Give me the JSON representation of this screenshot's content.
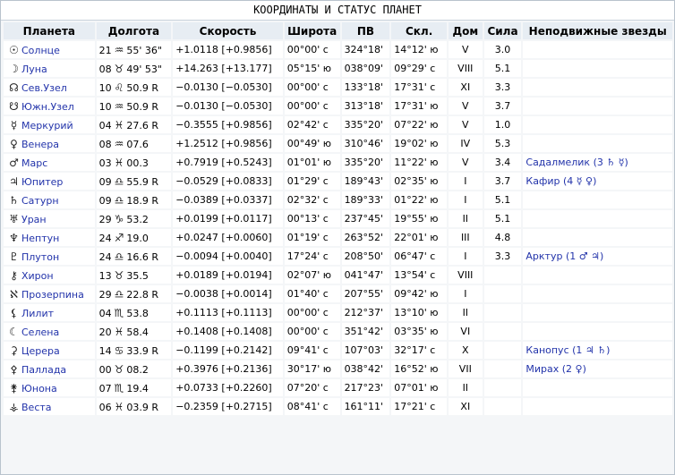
{
  "title": "КООРДИНАТЫ И СТАТУС ПЛАНЕТ",
  "headers": [
    "Планета",
    "Долгота",
    "Скорость",
    "Широта",
    "ПВ",
    "Скл.",
    "Дом",
    "Сила",
    "Неподвижные звезды"
  ],
  "rows": [
    {
      "icon": "sun-icon",
      "glyph": "☉",
      "name": "Солнце",
      "deg": "21",
      "sign": "♒",
      "min": "55' 36\"",
      "speed": "+1.0118 [+0.9856]",
      "lat": "00°00' с",
      "ra": "324°18'",
      "decl": "14°12' ю",
      "house": "V",
      "force": "3.0",
      "star": ""
    },
    {
      "icon": "moon-icon",
      "glyph": "☽",
      "name": "Луна",
      "deg": "08",
      "sign": "♉",
      "min": "49' 53\"",
      "speed": "+14.263 [+13.177]",
      "lat": "05°15' ю",
      "ra": "038°09'",
      "decl": "09°29' с",
      "house": "VIII",
      "force": "5.1",
      "star": ""
    },
    {
      "icon": "north-node-icon",
      "glyph": "☊",
      "name": "Сев.Узел",
      "deg": "10",
      "sign": "♌",
      "min": "50.9 R",
      "speed": "−0.0130 [−0.0530]",
      "lat": "00°00' с",
      "ra": "133°18'",
      "decl": "17°31' с",
      "house": "XI",
      "force": "3.3",
      "star": ""
    },
    {
      "icon": "south-node-icon",
      "glyph": "☋",
      "name": "Южн.Узел",
      "deg": "10",
      "sign": "♒",
      "min": "50.9 R",
      "speed": "−0.0130 [−0.0530]",
      "lat": "00°00' с",
      "ra": "313°18'",
      "decl": "17°31' ю",
      "house": "V",
      "force": "3.7",
      "star": ""
    },
    {
      "icon": "mercury-icon",
      "glyph": "☿",
      "name": "Меркурий",
      "deg": "04",
      "sign": "♓",
      "min": "27.6 R",
      "speed": "−0.3555 [+0.9856]",
      "lat": "02°42' с",
      "ra": "335°20'",
      "decl": "07°22' ю",
      "house": "V",
      "force": "1.0",
      "star": ""
    },
    {
      "icon": "venus-icon",
      "glyph": "♀",
      "name": "Венера",
      "deg": "08",
      "sign": "♒",
      "min": "07.6",
      "speed": "+1.2512 [+0.9856]",
      "lat": "00°49' ю",
      "ra": "310°46'",
      "decl": "19°02' ю",
      "house": "IV",
      "force": "5.3",
      "star": ""
    },
    {
      "icon": "mars-icon",
      "glyph": "♂",
      "name": "Марс",
      "deg": "03",
      "sign": "♓",
      "min": "00.3",
      "speed": "+0.7919 [+0.5243]",
      "lat": "01°01' ю",
      "ra": "335°20'",
      "decl": "11°22' ю",
      "house": "V",
      "force": "3.4",
      "star": "Садалмелик (3 ♄ ☿)"
    },
    {
      "icon": "jupiter-icon",
      "glyph": "♃",
      "name": "Юпитер",
      "deg": "09",
      "sign": "♎",
      "min": "55.9 R",
      "speed": "−0.0529 [+0.0833]",
      "lat": "01°29' с",
      "ra": "189°43'",
      "decl": "02°35' ю",
      "house": "I",
      "force": "3.7",
      "star": "Кафир (4 ☿ ♀)"
    },
    {
      "icon": "saturn-icon",
      "glyph": "♄",
      "name": "Сатурн",
      "deg": "09",
      "sign": "♎",
      "min": "18.9 R",
      "speed": "−0.0389 [+0.0337]",
      "lat": "02°32' с",
      "ra": "189°33'",
      "decl": "01°22' ю",
      "house": "I",
      "force": "5.1",
      "star": ""
    },
    {
      "icon": "uranus-icon",
      "glyph": "♅",
      "name": "Уран",
      "deg": "29",
      "sign": "♑",
      "min": "53.2",
      "speed": "+0.0199 [+0.0117]",
      "lat": "00°13' с",
      "ra": "237°45'",
      "decl": "19°55' ю",
      "house": "II",
      "force": "5.1",
      "star": ""
    },
    {
      "icon": "neptune-icon",
      "glyph": "♆",
      "name": "Нептун",
      "deg": "24",
      "sign": "♐",
      "min": "19.0",
      "speed": "+0.0247 [+0.0060]",
      "lat": "01°19' с",
      "ra": "263°52'",
      "decl": "22°01' ю",
      "house": "III",
      "force": "4.8",
      "star": ""
    },
    {
      "icon": "pluto-icon",
      "glyph": "♇",
      "name": "Плутон",
      "deg": "24",
      "sign": "♎",
      "min": "16.6 R",
      "speed": "−0.0094 [+0.0040]",
      "lat": "17°24' с",
      "ra": "208°50'",
      "decl": "06°47' с",
      "house": "I",
      "force": "3.3",
      "star": "Арктур (1 ♂ ♃)"
    },
    {
      "icon": "chiron-icon",
      "glyph": "⚷",
      "name": "Хирон",
      "deg": "13",
      "sign": "♉",
      "min": "35.5",
      "speed": "+0.0189 [+0.0194]",
      "lat": "02°07' ю",
      "ra": "041°47'",
      "decl": "13°54' с",
      "house": "VIII",
      "force": "",
      "star": ""
    },
    {
      "icon": "proserpina-icon",
      "glyph": "ℵ",
      "name": "Прозерпина",
      "deg": "29",
      "sign": "♎",
      "min": "22.8 R",
      "speed": "−0.0038 [+0.0014]",
      "lat": "01°40' с",
      "ra": "207°55'",
      "decl": "09°42' ю",
      "house": "I",
      "force": "",
      "star": ""
    },
    {
      "icon": "lilith-icon",
      "glyph": "⚸",
      "name": "Лилит",
      "deg": "04",
      "sign": "♏",
      "min": "53.8",
      "speed": "+0.1113 [+0.1113]",
      "lat": "00°00' с",
      "ra": "212°37'",
      "decl": "13°10' ю",
      "house": "II",
      "force": "",
      "star": ""
    },
    {
      "icon": "selena-icon",
      "glyph": "☾",
      "name": "Селена",
      "deg": "20",
      "sign": "♓",
      "min": "58.4",
      "speed": "+0.1408 [+0.1408]",
      "lat": "00°00' с",
      "ra": "351°42'",
      "decl": "03°35' ю",
      "house": "VI",
      "force": "",
      "star": ""
    },
    {
      "icon": "ceres-icon",
      "glyph": "⚳",
      "name": "Церера",
      "deg": "14",
      "sign": "♋",
      "min": "33.9 R",
      "speed": "−0.1199 [+0.2142]",
      "lat": "09°41' с",
      "ra": "107°03'",
      "decl": "32°17' с",
      "house": "X",
      "force": "",
      "star": "Канопус (1 ♃ ♄)"
    },
    {
      "icon": "pallas-icon",
      "glyph": "⚴",
      "name": "Паллада",
      "deg": "00",
      "sign": "♉",
      "min": "08.2",
      "speed": "+0.3976 [+0.2136]",
      "lat": "30°17' ю",
      "ra": "038°42'",
      "decl": "16°52' ю",
      "house": "VII",
      "force": "",
      "star": "Мирах (2 ♀)"
    },
    {
      "icon": "juno-icon",
      "glyph": "⚵",
      "name": "Юнона",
      "deg": "07",
      "sign": "♏",
      "min": "19.4",
      "speed": "+0.0733 [+0.2260]",
      "lat": "07°20' с",
      "ra": "217°23'",
      "decl": "07°01' ю",
      "house": "II",
      "force": "",
      "star": ""
    },
    {
      "icon": "vesta-icon",
      "glyph": "⚶",
      "name": "Веста",
      "deg": "06",
      "sign": "♓",
      "min": "03.9 R",
      "speed": "−0.2359 [+0.2715]",
      "lat": "08°41' с",
      "ra": "161°11'",
      "decl": "17°21' с",
      "house": "XI",
      "force": "",
      "star": ""
    }
  ]
}
